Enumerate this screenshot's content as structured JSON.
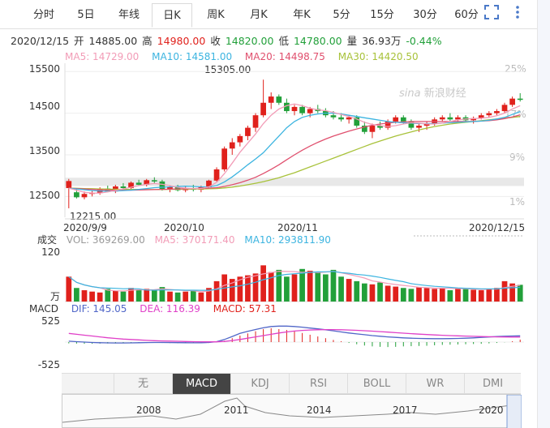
{
  "toolbar": {
    "tabs": [
      {
        "label": "分时",
        "active": false
      },
      {
        "label": "5日",
        "active": false
      },
      {
        "label": "年线",
        "active": false
      },
      {
        "label": "日K",
        "active": true
      },
      {
        "label": "周K",
        "active": false
      },
      {
        "label": "月K",
        "active": false
      },
      {
        "label": "年K",
        "active": false
      },
      {
        "label": "5分",
        "active": false
      },
      {
        "label": "15分",
        "active": false
      },
      {
        "label": "30分",
        "active": false
      },
      {
        "label": "60分",
        "active": false
      }
    ],
    "icons": [
      "fullscreen-icon",
      "more-vertical-icon"
    ]
  },
  "quote": {
    "date": "2020/12/15",
    "open_label": "开",
    "open": "14885.00",
    "high_label": "高",
    "high": "14980.00",
    "close_label": "收",
    "close": "14820.00",
    "low_label": "低",
    "low": "14780.00",
    "volume_label": "量",
    "volume": "36.93万",
    "change": "-0.44%"
  },
  "ma": {
    "ma5": "MA5: 14729.00",
    "ma10": "MA10: 14581.00",
    "ma20": "MA20: 14498.75",
    "ma30": "MA30: 14420.50"
  },
  "colors": {
    "up": "#e0211c",
    "down": "#22a03a",
    "ma5": "#f29cb7",
    "ma10": "#3cb4e0",
    "ma20": "#e0506e",
    "ma30": "#a8c23a",
    "dif": "#5066c8",
    "dea": "#e040c8"
  },
  "watermark": "新浪财经",
  "watermark_brand": "sina",
  "volume_panel": {
    "label": "成交",
    "vol": "VOL: 369269.00",
    "ma5": "MA5: 370171.40",
    "ma10": "MA10: 293811.90",
    "top_tick": "120",
    "unit": "万"
  },
  "macd_panel": {
    "label": "MACD",
    "dif": "DIF: 145.05",
    "dea": "DEA: 116.39",
    "macd": "MACD: 57.31",
    "top_tick": "525",
    "bottom_tick": "-525"
  },
  "indicator_tabs": [
    {
      "label": "无",
      "active": false
    },
    {
      "label": "MACD",
      "active": true
    },
    {
      "label": "KDJ",
      "active": false
    },
    {
      "label": "RSI",
      "active": false
    },
    {
      "label": "BOLL",
      "active": false
    },
    {
      "label": "WR",
      "active": false
    },
    {
      "label": "DMI",
      "active": false
    }
  ],
  "overview_years": [
    "2008",
    "2011",
    "2014",
    "2017",
    "2020"
  ],
  "chart_data": {
    "type": "candlestick",
    "y_ticks": [
      "15500",
      "14500",
      "13500",
      "12500"
    ],
    "pct_ticks": [
      "25%",
      "17%",
      "9%",
      "1%"
    ],
    "x_ticks": [
      "2020/9/9",
      "2020/10",
      "2020/11",
      "2020/12/15"
    ],
    "ylim": [
      12000,
      15700
    ],
    "annotations": {
      "max": "15305.00",
      "min": "12215.00"
    },
    "ohlc": [
      [
        12700,
        12920,
        12215,
        12870
      ],
      [
        12600,
        12700,
        12450,
        12480
      ],
      [
        12480,
        12620,
        12430,
        12560
      ],
      [
        12560,
        12650,
        12500,
        12580
      ],
      [
        12580,
        12720,
        12540,
        12690
      ],
      [
        12690,
        12760,
        12600,
        12620
      ],
      [
        12620,
        12780,
        12580,
        12740
      ],
      [
        12740,
        12820,
        12680,
        12700
      ],
      [
        12700,
        12860,
        12660,
        12830
      ],
      [
        12830,
        12900,
        12760,
        12780
      ],
      [
        12780,
        12920,
        12740,
        12890
      ],
      [
        12890,
        12960,
        12820,
        12860
      ],
      [
        12860,
        12900,
        12640,
        12680
      ],
      [
        12680,
        12760,
        12600,
        12720
      ],
      [
        12720,
        12780,
        12620,
        12650
      ],
      [
        12650,
        12740,
        12600,
        12700
      ],
      [
        12700,
        12780,
        12620,
        12660
      ],
      [
        12660,
        12760,
        12600,
        12720
      ],
      [
        12720,
        12900,
        12700,
        12880
      ],
      [
        12880,
        13200,
        12860,
        13150
      ],
      [
        13150,
        13700,
        13100,
        13650
      ],
      [
        13650,
        13900,
        13500,
        13800
      ],
      [
        13800,
        14000,
        13700,
        13950
      ],
      [
        13950,
        14200,
        13850,
        14150
      ],
      [
        14150,
        14500,
        14050,
        14450
      ],
      [
        14450,
        15305,
        14400,
        14750
      ],
      [
        14750,
        15000,
        14600,
        14900
      ],
      [
        14900,
        14950,
        14700,
        14750
      ],
      [
        14750,
        14850,
        14500,
        14550
      ],
      [
        14550,
        14700,
        14450,
        14650
      ],
      [
        14650,
        14700,
        14450,
        14500
      ],
      [
        14500,
        14650,
        14400,
        14600
      ],
      [
        14600,
        14700,
        14500,
        14550
      ],
      [
        14550,
        14620,
        14400,
        14450
      ],
      [
        14450,
        14550,
        14350,
        14400
      ],
      [
        14400,
        14500,
        14300,
        14350
      ],
      [
        14350,
        14450,
        14250,
        14400
      ],
      [
        14400,
        14450,
        14150,
        14200
      ],
      [
        14200,
        14300,
        14000,
        14050
      ],
      [
        14050,
        14250,
        13900,
        14200
      ],
      [
        14200,
        14300,
        14100,
        14150
      ],
      [
        14150,
        14350,
        14100,
        14300
      ],
      [
        14300,
        14450,
        14250,
        14400
      ],
      [
        14400,
        14450,
        14250,
        14300
      ],
      [
        14300,
        14350,
        14100,
        14150
      ],
      [
        14150,
        14250,
        14050,
        14200
      ],
      [
        14200,
        14300,
        14100,
        14250
      ],
      [
        14250,
        14400,
        14200,
        14350
      ],
      [
        14350,
        14450,
        14300,
        14400
      ],
      [
        14400,
        14500,
        14300,
        14350
      ],
      [
        14350,
        14450,
        14250,
        14400
      ],
      [
        14400,
        14450,
        14300,
        14330
      ],
      [
        14330,
        14420,
        14250,
        14380
      ],
      [
        14380,
        14500,
        14350,
        14450
      ],
      [
        14450,
        14550,
        14400,
        14500
      ],
      [
        14500,
        14600,
        14450,
        14550
      ],
      [
        14550,
        14750,
        14500,
        14700
      ],
      [
        14700,
        14900,
        14650,
        14850
      ],
      [
        14850,
        14980,
        14780,
        14820
      ]
    ],
    "ma5": [
      12700,
      12650,
      12600,
      12580,
      12580,
      12610,
      12640,
      12680,
      12720,
      12760,
      12790,
      12810,
      12790,
      12760,
      12720,
      12700,
      12690,
      12690,
      12730,
      12840,
      13050,
      13300,
      13560,
      13780,
      14000,
      14250,
      14450,
      14600,
      14680,
      14720,
      14680,
      14620,
      14580,
      14560,
      14520,
      14470,
      14420,
      14360,
      14280,
      14230,
      14200,
      14180,
      14200,
      14240,
      14270,
      14260,
      14240,
      14240,
      14260,
      14300,
      14340,
      14360,
      14370,
      14380,
      14400,
      14440,
      14500,
      14600,
      14680
    ],
    "ma10": [
      12700,
      12680,
      12660,
      12640,
      12630,
      12625,
      12630,
      12640,
      12650,
      12670,
      12690,
      12710,
      12720,
      12730,
      12740,
      12745,
      12740,
      12730,
      12730,
      12760,
      12850,
      12970,
      13110,
      13260,
      13400,
      13550,
      13750,
      13950,
      14150,
      14300,
      14400,
      14450,
      14480,
      14500,
      14500,
      14480,
      14450,
      14420,
      14390,
      14360,
      14330,
      14300,
      14280,
      14270,
      14260,
      14250,
      14250,
      14250,
      14260,
      14270,
      14280,
      14290,
      14300,
      14310,
      14330,
      14360,
      14400,
      14470,
      14540
    ],
    "ma20": [
      12700,
      12690,
      12680,
      12670,
      12660,
      12655,
      12650,
      12650,
      12650,
      12655,
      12660,
      12665,
      12670,
      12675,
      12680,
      12685,
      12690,
      12695,
      12700,
      12710,
      12740,
      12780,
      12830,
      12890,
      12960,
      13050,
      13150,
      13260,
      13380,
      13500,
      13610,
      13710,
      13800,
      13880,
      13950,
      14010,
      14070,
      14120,
      14170,
      14210,
      14240,
      14260,
      14280,
      14290,
      14300,
      14300,
      14300,
      14300,
      14300,
      14300,
      14300,
      14300,
      14300,
      14310,
      14320,
      14340,
      14370,
      14410,
      14460
    ],
    "ma30": [
      12700,
      12695,
      12690,
      12685,
      12680,
      12675,
      12672,
      12670,
      12668,
      12667,
      12666,
      12666,
      12667,
      12669,
      12671,
      12674,
      12677,
      12680,
      12684,
      12690,
      12705,
      12725,
      12750,
      12780,
      12815,
      12855,
      12900,
      12950,
      13010,
      13070,
      13140,
      13210,
      13280,
      13350,
      13420,
      13490,
      13560,
      13630,
      13700,
      13770,
      13830,
      13890,
      13950,
      14000,
      14050,
      14100,
      14140,
      14180,
      14210,
      14240,
      14260,
      14280,
      14300,
      14320,
      14340,
      14360,
      14380,
      14400,
      14420
    ],
    "volume": [
      55,
      30,
      25,
      22,
      20,
      28,
      24,
      22,
      30,
      26,
      28,
      25,
      32,
      22,
      20,
      22,
      24,
      20,
      30,
      45,
      60,
      50,
      55,
      58,
      62,
      80,
      65,
      70,
      55,
      60,
      72,
      68,
      65,
      60,
      70,
      55,
      50,
      45,
      40,
      38,
      42,
      35,
      33,
      30,
      28,
      32,
      30,
      28,
      30,
      25,
      30,
      28,
      26,
      25,
      28,
      30,
      45,
      40,
      37
    ],
    "vol_up": [
      1,
      0,
      1,
      1,
      1,
      0,
      1,
      0,
      1,
      0,
      1,
      0,
      0,
      1,
      0,
      1,
      0,
      1,
      1,
      1,
      1,
      1,
      1,
      1,
      1,
      1,
      1,
      0,
      0,
      1,
      0,
      1,
      0,
      0,
      0,
      0,
      1,
      0,
      0,
      1,
      0,
      1,
      1,
      0,
      0,
      1,
      1,
      1,
      1,
      0,
      1,
      0,
      1,
      1,
      1,
      1,
      1,
      1,
      0
    ],
    "macd_hist": [
      -30,
      -35,
      -40,
      -38,
      -35,
      -32,
      -30,
      -28,
      -25,
      -22,
      -20,
      -18,
      -20,
      -22,
      -25,
      -26,
      -27,
      -26,
      -20,
      -5,
      30,
      90,
      150,
      200,
      250,
      300,
      320,
      300,
      280,
      250,
      210,
      170,
      130,
      90,
      50,
      20,
      -20,
      -50,
      -80,
      -100,
      -110,
      -115,
      -110,
      -100,
      -95,
      -90,
      -85,
      -75,
      -65,
      -60,
      -55,
      -50,
      -45,
      -40,
      -30,
      -20,
      -5,
      20,
      57
    ],
    "dif": [
      20,
      10,
      0,
      -10,
      -15,
      -18,
      -20,
      -20,
      -18,
      -15,
      -12,
      -10,
      -10,
      -12,
      -14,
      -15,
      -16,
      -15,
      -10,
      10,
      60,
      130,
      200,
      250,
      290,
      330,
      360,
      370,
      370,
      360,
      345,
      325,
      305,
      285,
      260,
      235,
      210,
      190,
      170,
      150,
      135,
      120,
      108,
      98,
      90,
      84,
      80,
      78,
      78,
      80,
      84,
      90,
      98,
      108,
      118,
      128,
      135,
      140,
      145
    ],
    "dea": [
      200,
      180,
      160,
      140,
      120,
      100,
      85,
      70,
      60,
      50,
      40,
      32,
      26,
      22,
      18,
      14,
      10,
      7,
      5,
      6,
      15,
      35,
      60,
      90,
      120,
      150,
      180,
      210,
      235,
      255,
      270,
      280,
      285,
      288,
      288,
      285,
      280,
      272,
      263,
      253,
      242,
      230,
      218,
      206,
      195,
      184,
      174,
      165,
      157,
      150,
      144,
      138,
      133,
      128,
      124,
      120,
      118,
      117,
      116
    ]
  }
}
